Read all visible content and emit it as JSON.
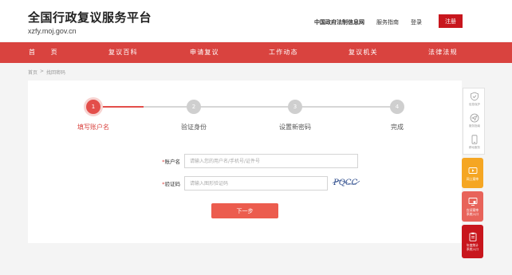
{
  "header": {
    "title": "全国行政复议服务平台",
    "domain": "xzfy.moj.gov.cn",
    "links": [
      "中国政府法制信息网",
      "服务指南",
      "登录"
    ],
    "register_label": "注册"
  },
  "nav": {
    "items": [
      "首　　页",
      "复议百科",
      "申请复议",
      "工作动态",
      "复议机关",
      "法律法规"
    ]
  },
  "breadcrumb": {
    "home": "首页",
    "separator": ">",
    "current": "找回密码"
  },
  "steps": [
    {
      "num": "1",
      "label": "填写账户名",
      "active": true
    },
    {
      "num": "2",
      "label": "验证身份",
      "active": false
    },
    {
      "num": "3",
      "label": "设置新密码",
      "active": false
    },
    {
      "num": "4",
      "label": "完成",
      "active": false
    }
  ],
  "form": {
    "required_mark": "*",
    "account_label": "账户名",
    "account_placeholder": "请输入您的用户名/手机号/证件号",
    "captcha_label": "验证码",
    "captcha_placeholder": "请输入图形验证码",
    "captcha_text": "PQCC",
    "next_label": "下一步"
  },
  "side_panel": {
    "items": [
      {
        "icon": "shield-icon",
        "label": "信息保护"
      },
      {
        "icon": "send-icon",
        "label": "服务指南"
      },
      {
        "icon": "phone-icon",
        "label": "移动服务"
      }
    ]
  },
  "side_buttons": [
    {
      "icon": "video-icon",
      "label": "网上案审",
      "color": "#f5a623"
    },
    {
      "icon": "monitor-icon",
      "label": "应诉案审\n系统入口",
      "color": "#e8635a"
    },
    {
      "icon": "clipboard-icon",
      "label": "年度统计\n系统入口",
      "color": "#c8161d"
    }
  ],
  "colors": {
    "brand_red": "#d9433f",
    "register_red": "#c8161d",
    "step_active": "#e34e4a",
    "button": "#ec5c4e"
  }
}
